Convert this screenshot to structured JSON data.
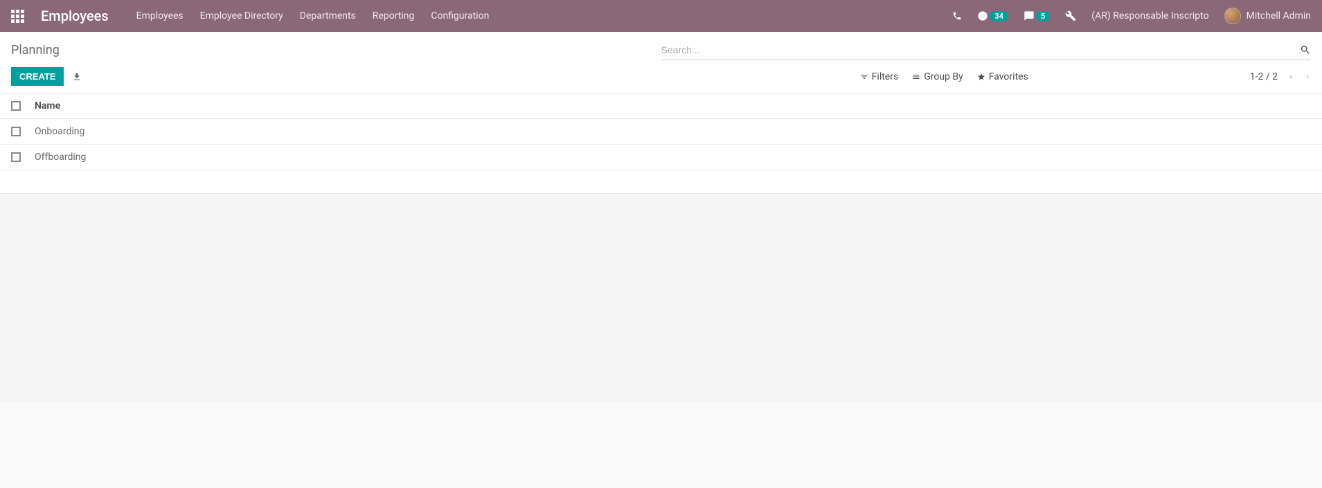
{
  "navbar": {
    "app_title": "Employees",
    "menu": [
      "Employees",
      "Employee Directory",
      "Departments",
      "Reporting",
      "Configuration"
    ],
    "activity_count": "34",
    "message_count": "5",
    "company_name": "(AR) Responsable Inscripto",
    "user_name": "Mitchell Admin"
  },
  "breadcrumb": "Planning",
  "search": {
    "placeholder": "Search..."
  },
  "buttons": {
    "create": "CREATE",
    "filters": "Filters",
    "groupby": "Group By",
    "favorites": "Favorites"
  },
  "pager": {
    "range": "1-2 / 2"
  },
  "list": {
    "header": "Name",
    "rows": [
      {
        "name": "Onboarding"
      },
      {
        "name": "Offboarding"
      }
    ]
  }
}
